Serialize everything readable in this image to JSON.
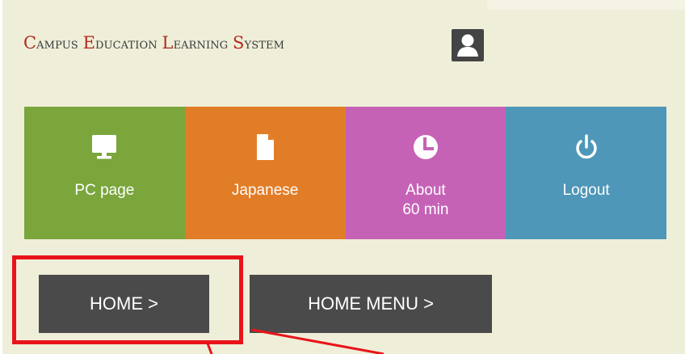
{
  "header": {
    "title_parts": [
      {
        "cap": "C",
        "rest": "ampus"
      },
      {
        "cap": "E",
        "rest": "ducation"
      },
      {
        "cap": "L",
        "rest": "earning"
      },
      {
        "cap": "S",
        "rest": "ystem"
      }
    ],
    "avatar_icon": "user-icon"
  },
  "tiles": [
    {
      "label": "PC page",
      "icon": "monitor-icon",
      "color": "#7aa63c"
    },
    {
      "label": "Japanese",
      "icon": "document-icon",
      "color": "#e27d27"
    },
    {
      "label": "About\n60 min",
      "icon": "clock-icon",
      "color": "#c562b6"
    },
    {
      "label": "Logout",
      "icon": "power-icon",
      "color": "#4e97b8"
    }
  ],
  "nav": {
    "home_label": "HOME >",
    "home_menu_label": "HOME MENU >"
  },
  "annotation": {
    "highlight_color": "#e8141a"
  }
}
